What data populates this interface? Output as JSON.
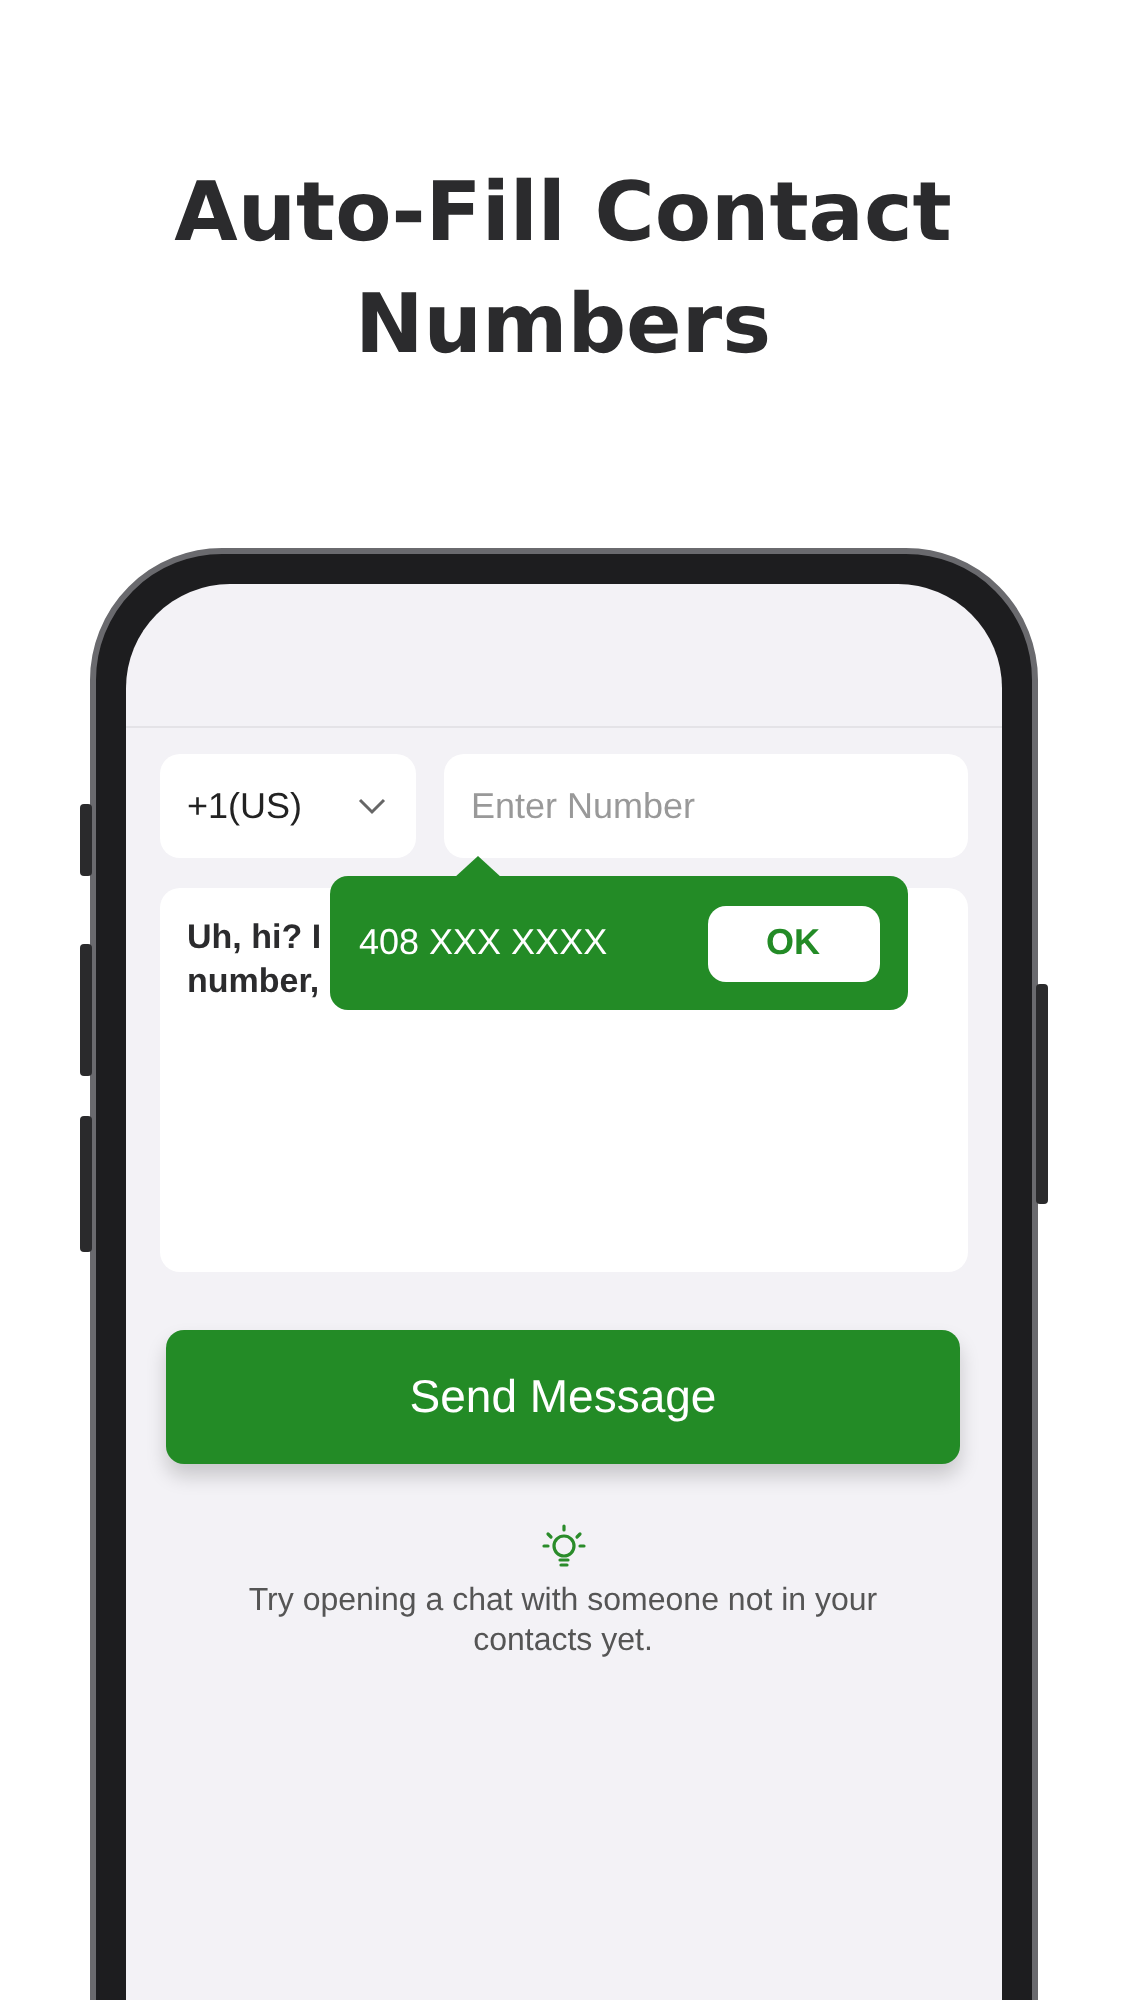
{
  "headline": "Auto-Fill Contact Numbers",
  "country_select": {
    "value": "+1(US)"
  },
  "number_field": {
    "placeholder": "Enter Number"
  },
  "message": {
    "lines": [
      "Uh, hi? I",
      "number,"
    ]
  },
  "autofill_popup": {
    "number": "408 XXX XXXX",
    "button": "OK"
  },
  "send_button": "Send Message",
  "hint": "Try opening a chat with someone not in your contacts yet."
}
